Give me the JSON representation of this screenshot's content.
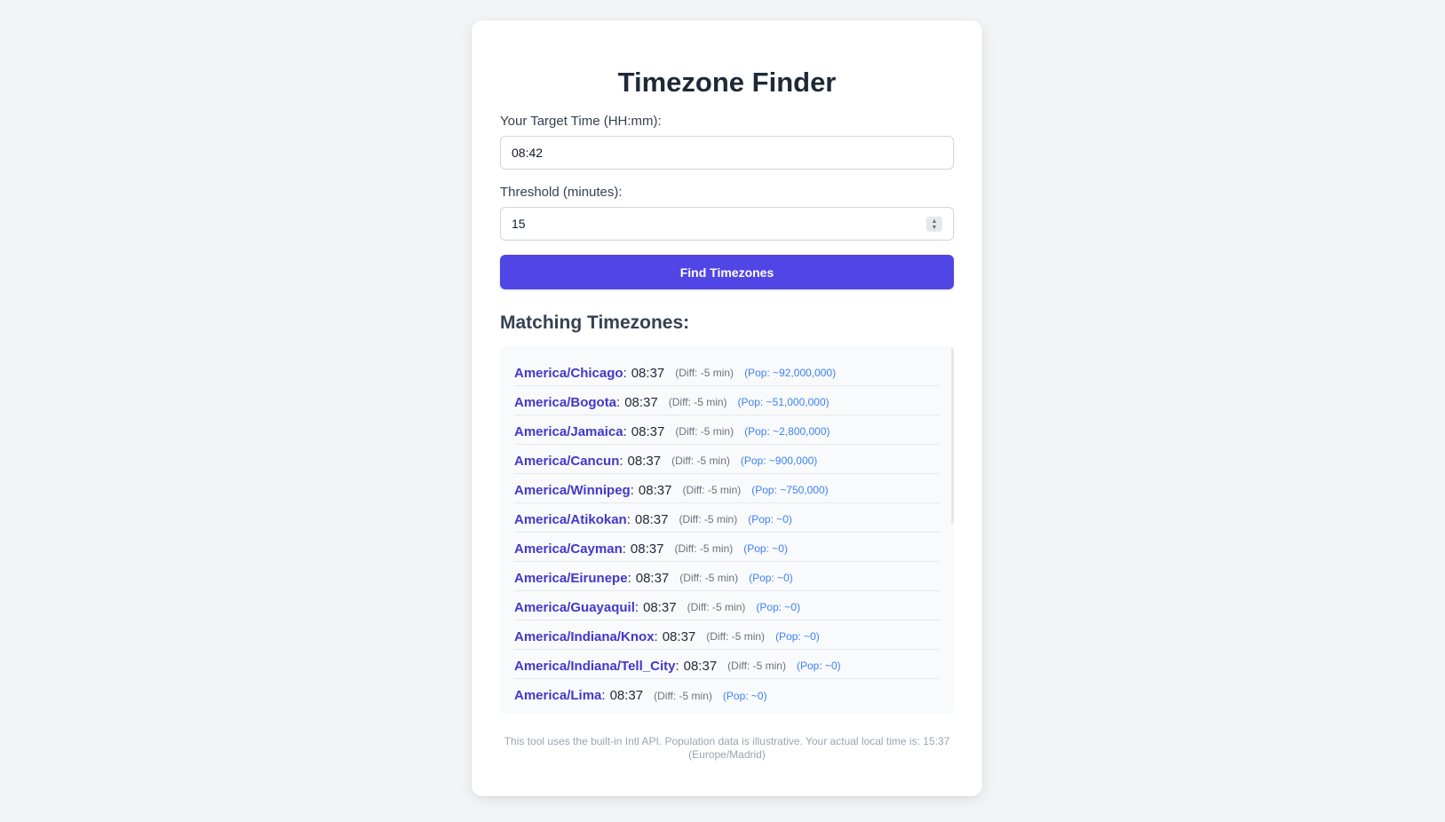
{
  "title": "Timezone Finder",
  "form": {
    "time_label": "Your Target Time (HH:mm):",
    "time_value": "08:42",
    "threshold_label": "Threshold (minutes):",
    "threshold_value": "15",
    "button_label": "Find Timezones"
  },
  "results": {
    "heading": "Matching Timezones:",
    "items": [
      {
        "tz": "America/Chicago",
        "time": "08:37",
        "diff": "(Diff: -5 min)",
        "pop": "(Pop: ~92,000,000)"
      },
      {
        "tz": "America/Bogota",
        "time": "08:37",
        "diff": "(Diff: -5 min)",
        "pop": "(Pop: ~51,000,000)"
      },
      {
        "tz": "America/Jamaica",
        "time": "08:37",
        "diff": "(Diff: -5 min)",
        "pop": "(Pop: ~2,800,000)"
      },
      {
        "tz": "America/Cancun",
        "time": "08:37",
        "diff": "(Diff: -5 min)",
        "pop": "(Pop: ~900,000)"
      },
      {
        "tz": "America/Winnipeg",
        "time": "08:37",
        "diff": "(Diff: -5 min)",
        "pop": "(Pop: ~750,000)"
      },
      {
        "tz": "America/Atikokan",
        "time": "08:37",
        "diff": "(Diff: -5 min)",
        "pop": "(Pop: ~0)"
      },
      {
        "tz": "America/Cayman",
        "time": "08:37",
        "diff": "(Diff: -5 min)",
        "pop": "(Pop: ~0)"
      },
      {
        "tz": "America/Eirunepe",
        "time": "08:37",
        "diff": "(Diff: -5 min)",
        "pop": "(Pop: ~0)"
      },
      {
        "tz": "America/Guayaquil",
        "time": "08:37",
        "diff": "(Diff: -5 min)",
        "pop": "(Pop: ~0)"
      },
      {
        "tz": "America/Indiana/Knox",
        "time": "08:37",
        "diff": "(Diff: -5 min)",
        "pop": "(Pop: ~0)"
      },
      {
        "tz": "America/Indiana/Tell_City",
        "time": "08:37",
        "diff": "(Diff: -5 min)",
        "pop": "(Pop: ~0)"
      },
      {
        "tz": "America/Lima",
        "time": "08:37",
        "diff": "(Diff: -5 min)",
        "pop": "(Pop: ~0)"
      }
    ]
  },
  "footer": "This tool uses the built-in Intl API. Population data is illustrative. Your actual local time is: 15:37 (Europe/Madrid)",
  "colors": {
    "accent": "#4f46e5",
    "tz_name": "#4338ca",
    "pop": "#3b82f6",
    "background": "#f3f4f6"
  },
  "icons": {
    "stepper": "spinner-arrows-icon"
  }
}
